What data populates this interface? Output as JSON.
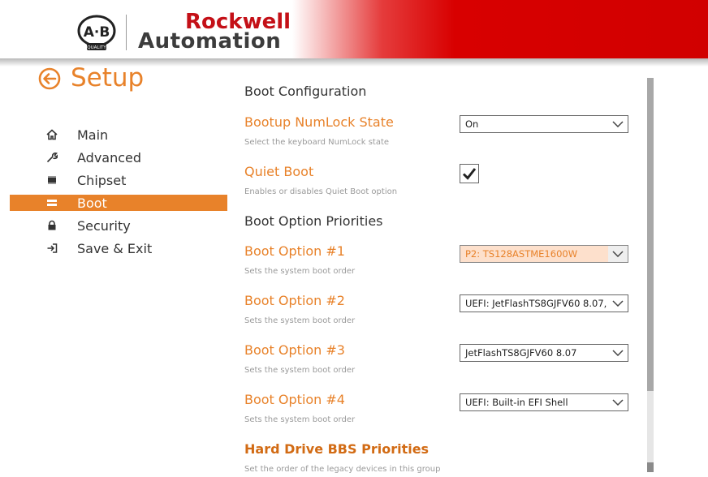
{
  "brand": {
    "logo_text": "A·B",
    "logo_sub": "QUALITY",
    "line1": "Rockwell",
    "line2": "Automation"
  },
  "header": {
    "title": "Setup",
    "back_icon": "arrow-left-circle-icon"
  },
  "sidebar": {
    "items": [
      {
        "label": "Main",
        "icon": "home-icon",
        "active": false
      },
      {
        "label": "Advanced",
        "icon": "wrench-icon",
        "active": false
      },
      {
        "label": "Chipset",
        "icon": "chip-icon",
        "active": false
      },
      {
        "label": "Boot",
        "icon": "drive-icon",
        "active": true
      },
      {
        "label": "Security",
        "icon": "lock-icon",
        "active": false
      },
      {
        "label": "Save & Exit",
        "icon": "exit-icon",
        "active": false
      }
    ]
  },
  "main": {
    "boot_configuration": "Boot Configuration",
    "numlock": {
      "title": "Bootup NumLock State",
      "help": "Select the keyboard NumLock state",
      "value": "On"
    },
    "quiet_boot": {
      "title": "Quiet Boot",
      "help": "Enables or disables Quiet Boot option",
      "checked": true
    },
    "boot_option_priorities": "Boot Option Priorities",
    "boot_options": [
      {
        "title": "Boot Option #1",
        "help": "Sets the system boot order",
        "value": "P2: TS128ASTME1600W"
      },
      {
        "title": "Boot Option #2",
        "help": "Sets the system boot order",
        "value": "UEFI: JetFlashTS8GJFV60 8.07,"
      },
      {
        "title": "Boot Option #3",
        "help": "Sets the system boot order",
        "value": "JetFlashTS8GJFV60 8.07"
      },
      {
        "title": "Boot Option #4",
        "help": "Sets the system boot order",
        "value": "UEFI: Built-in EFI Shell"
      }
    ],
    "hdd_bbs": {
      "title": "Hard Drive BBS Priorities",
      "help": "Set the order of the legacy devices in this group"
    }
  },
  "colors": {
    "accent": "#e8822a",
    "brand_red": "#c41017",
    "banner_red": "#d10000",
    "highlight_bg": "#fde0cc"
  }
}
